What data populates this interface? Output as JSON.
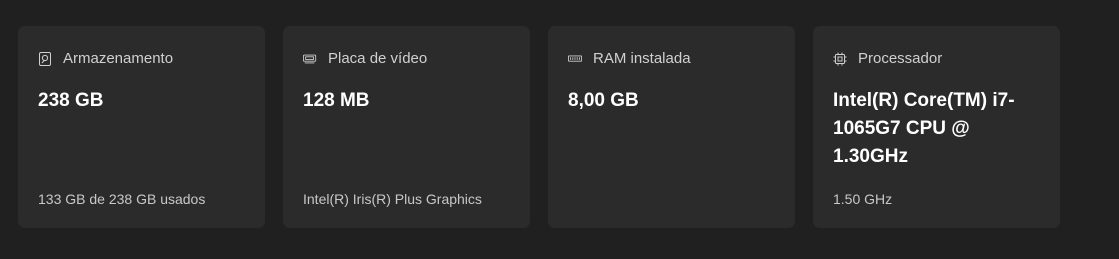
{
  "cards": [
    {
      "icon": "storage-icon",
      "label": "Armazenamento",
      "value": "238 GB",
      "detail": "133 GB de 238 GB usados"
    },
    {
      "icon": "graphics-card-icon",
      "label": "Placa de vídeo",
      "value": "128 MB",
      "detail": "Intel(R) Iris(R) Plus Graphics"
    },
    {
      "icon": "ram-icon",
      "label": "RAM instalada",
      "value": "8,00 GB",
      "detail": ""
    },
    {
      "icon": "processor-icon",
      "label": "Processador",
      "value": "Intel(R) Core(TM) i7-1065G7 CPU @ 1.30GHz",
      "detail": "1.50 GHz"
    }
  ]
}
